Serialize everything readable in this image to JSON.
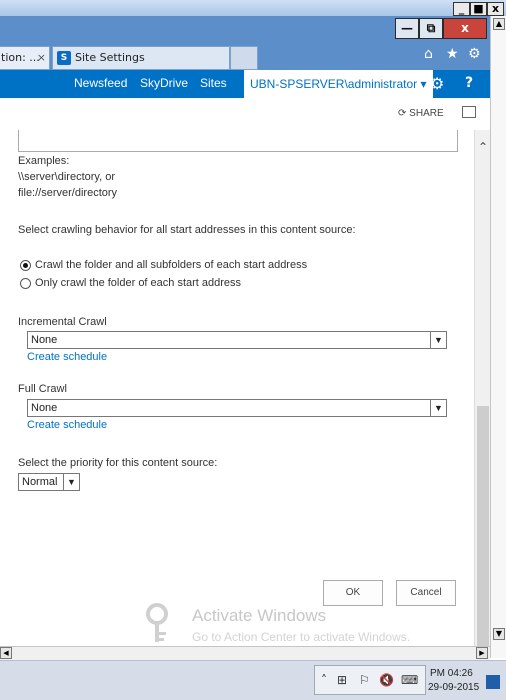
{
  "window": {
    "min_glyph": "_",
    "max_glyph": "□",
    "close_glyph": "x"
  },
  "tabs": [
    {
      "label": "tion: ...",
      "close": "×"
    },
    {
      "label": "Site Settings",
      "icon": "S"
    },
    {
      "label": ""
    }
  ],
  "ie_icons": {
    "home": "⌂",
    "star": "★",
    "gear": "⚙"
  },
  "suitebar": {
    "newsfeed": "Newsfeed",
    "skydrive": "SkyDrive",
    "sites": "Sites",
    "user": "UBN-SPSERVER\\administrator ▾",
    "settings_glyph": "⚙",
    "help_glyph": "?"
  },
  "ribbon": {
    "share": "SHARE",
    "share_icon": "⟳"
  },
  "content": {
    "examples_label": "Examples:",
    "example_1": "\\\\server\\directory, or",
    "example_2": "file://server/directory",
    "crawl_behavior_label": "Select crawling behavior for all start addresses in this content source:",
    "option_all": "Crawl the folder and all subfolders of each start address",
    "option_folder_only": "Only crawl the folder of each start address",
    "incremental_label": "Incremental Crawl",
    "incremental_value": "None",
    "incremental_link": "Create schedule",
    "full_label": "Full Crawl",
    "full_value": "None",
    "full_link": "Create schedule",
    "priority_label": "Select the priority for this content source:",
    "priority_value": "Normal",
    "ok_label": "OK",
    "cancel_label": "Cancel"
  },
  "watermark": {
    "title": "Activate Windows",
    "subtitle": "Go to Action Center to activate Windows."
  },
  "taskbar": {
    "time": "PM 04:26",
    "date": "29-09-2015",
    "tray_up": "˄"
  },
  "colors": {
    "suitebar": "#0072c6",
    "link": "#0072c6",
    "title_bar": "#5c8fc9"
  }
}
